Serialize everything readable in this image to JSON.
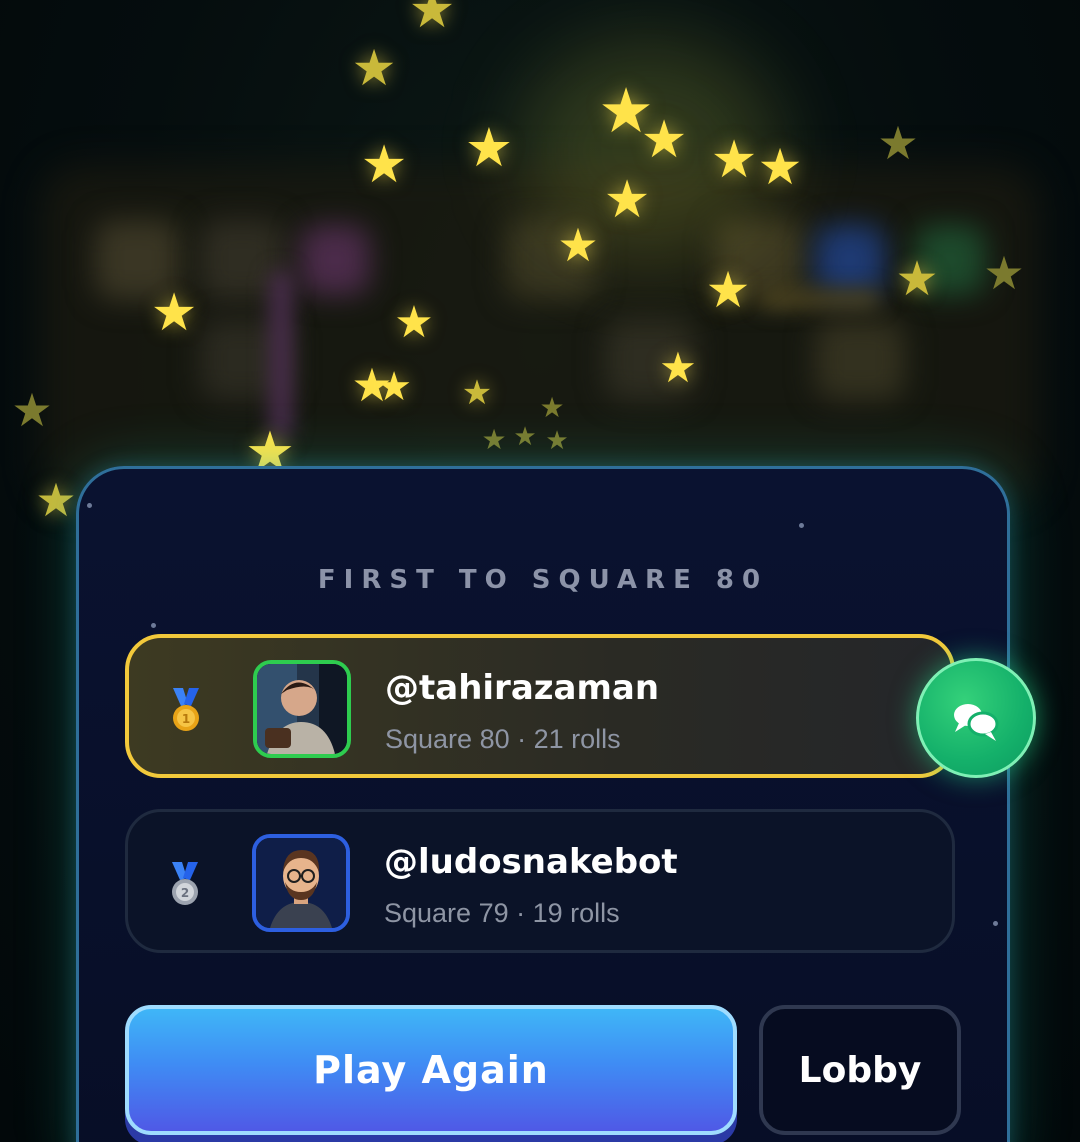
{
  "result": {
    "subtitle": "FIRST TO SQUARE 80",
    "players": [
      {
        "rank": 1,
        "medal": "gold-medal-icon",
        "username": "@tahirazaman",
        "stats": "Square 80 · 21 rolls",
        "avatar": "photo-avatar",
        "highlight_color": "#f2c93b"
      },
      {
        "rank": 2,
        "medal": "silver-medal-icon",
        "username": "@ludosnakebot",
        "stats": "Square 79 · 19 rolls",
        "avatar": "bot-avatar",
        "highlight_color": "#2d5fe0"
      }
    ]
  },
  "chat": {
    "icon": "chat-bubbles-icon",
    "color": "#14b06a"
  },
  "actions": {
    "play_again_label": "Play Again",
    "lobby_label": "Lobby"
  },
  "theme": {
    "panel_bg": "#0a1230",
    "accent_blue": "#3f8cf4",
    "star_color": "#ffe34a"
  }
}
